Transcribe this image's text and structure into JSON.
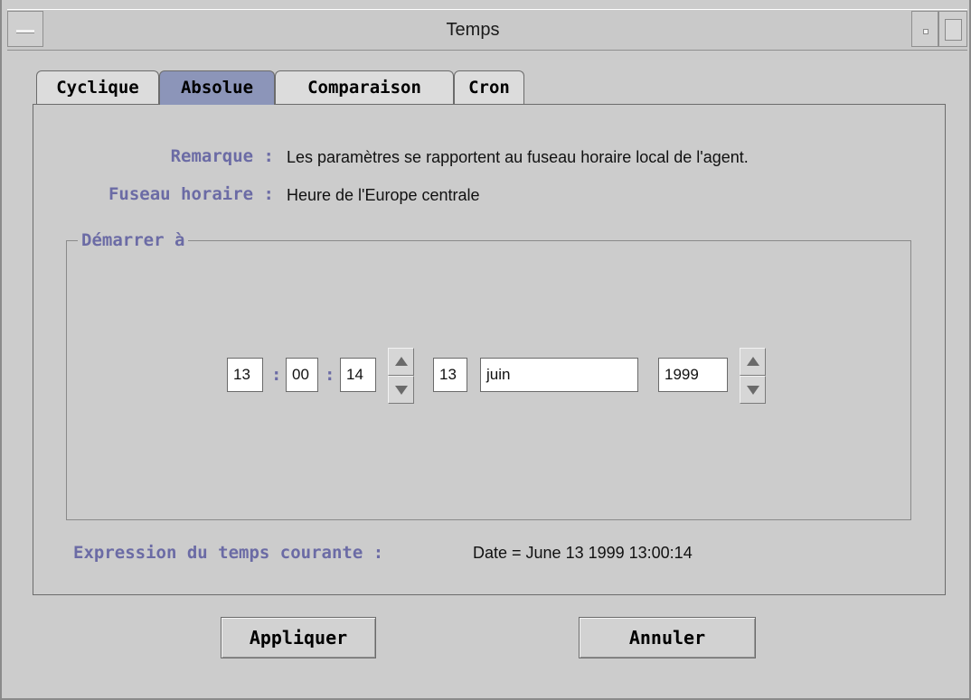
{
  "window": {
    "title": "Temps"
  },
  "tabs": [
    {
      "label": "Cyclique",
      "active": false
    },
    {
      "label": "Absolue",
      "active": true
    },
    {
      "label": "Comparaison",
      "active": false
    },
    {
      "label": "Cron",
      "active": false
    }
  ],
  "info": {
    "remark_label": "Remarque :",
    "remark_text": "Les paramètres se rapportent au fuseau horaire local de l'agent.",
    "timezone_label": "Fuseau horaire :",
    "timezone_text": "Heure de l'Europe centrale"
  },
  "start": {
    "group_title": "Démarrer à",
    "hour": "13",
    "minute": "00",
    "second": "14",
    "time_separator": ":",
    "day": "13",
    "month": "juin",
    "year": "1999"
  },
  "expression": {
    "label": "Expression du temps courante :",
    "value": "Date = June 13 1999 13:00:14"
  },
  "buttons": {
    "apply": "Appliquer",
    "cancel": "Annuler"
  },
  "colors": {
    "background": "#cccccc",
    "active_tab": "#8c95b9",
    "label_accent": "#6b6ba5"
  }
}
